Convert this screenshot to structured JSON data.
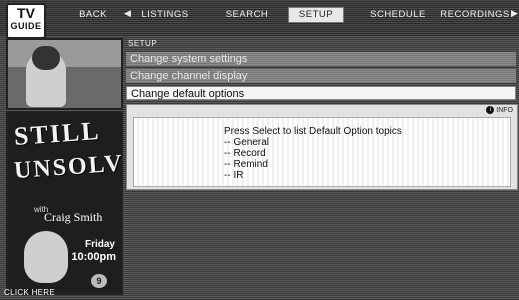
{
  "logo": {
    "line1": "TV",
    "line2": "GUIDE"
  },
  "nav": {
    "back_arrow": "◀",
    "forward_arrow": "▶",
    "tabs": [
      {
        "label": "BACK"
      },
      {
        "label": "LISTINGS"
      },
      {
        "label": "SEARCH"
      },
      {
        "label": "SETUP"
      },
      {
        "label": "SCHEDULE"
      },
      {
        "label": "RECORDINGS"
      }
    ]
  },
  "ad": {
    "title_line1": "STILL",
    "title_line2": "UNSOLVED",
    "with_label": "with",
    "host": "Craig Smith",
    "day": "Friday",
    "time": "10:00pm",
    "channel_label": "9",
    "cta": "CLICK HERE"
  },
  "menu": {
    "header": "SETUP",
    "items": [
      {
        "label": "Change system settings"
      },
      {
        "label": "Change channel display"
      },
      {
        "label": "Change default options"
      }
    ],
    "selected_index": 2
  },
  "info_panel": {
    "tag": "INFO",
    "heading": "Press Select to list Default Option topics",
    "topics": [
      "-- General",
      "-- Record",
      "-- Remind",
      "-- IR"
    ]
  },
  "colors": {
    "selected_bg": "#f4f4f4",
    "panel_bg": "#e2e2e2",
    "screen_bg": "#4a4a4a"
  }
}
